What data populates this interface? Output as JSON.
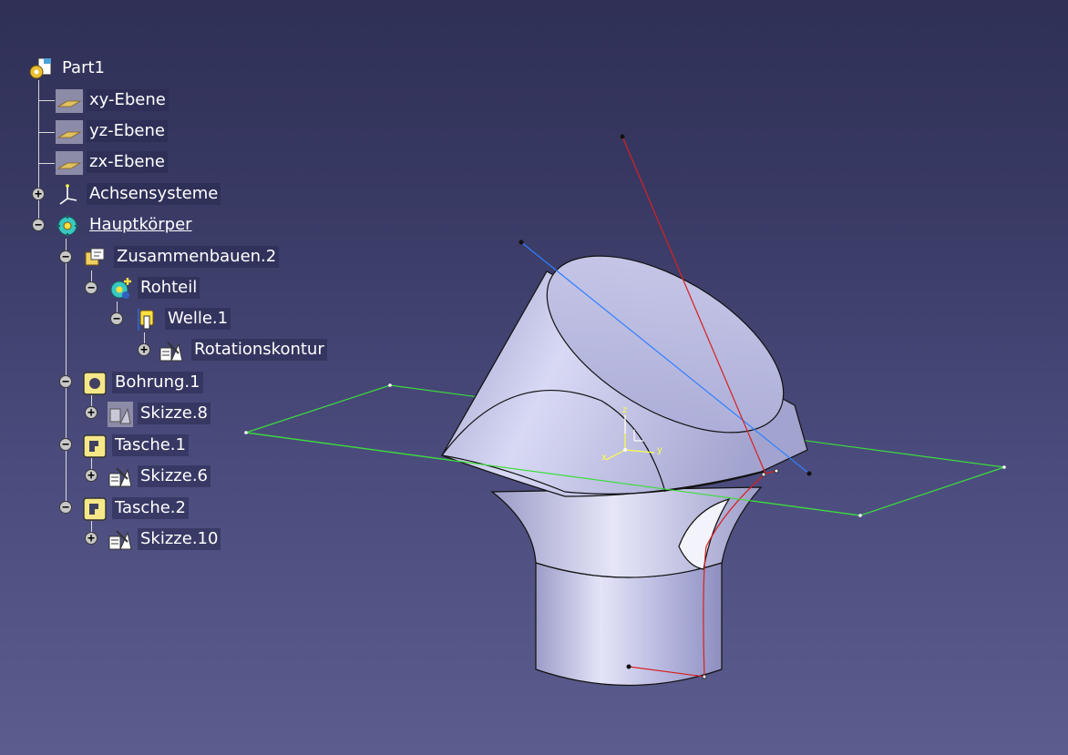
{
  "tree": {
    "root": {
      "label": "Part1",
      "icon": "part-icon"
    },
    "items": [
      {
        "id": "xy",
        "label": "xy-Ebene",
        "icon": "plane-icon"
      },
      {
        "id": "yz",
        "label": "yz-Ebene",
        "icon": "plane-icon"
      },
      {
        "id": "zx",
        "label": "zx-Ebene",
        "icon": "plane-icon"
      },
      {
        "id": "axes",
        "label": "Achsensysteme",
        "icon": "axis-system-icon",
        "toggle": "+"
      },
      {
        "id": "body",
        "label": "Hauptkörper",
        "icon": "body-icon",
        "toggle": "−"
      },
      {
        "id": "assemble",
        "label": "Zusammenbauen.2",
        "icon": "assemble-icon",
        "toggle": "−"
      },
      {
        "id": "rohteil",
        "label": "Rohteil",
        "icon": "body-icon",
        "toggle": "−"
      },
      {
        "id": "welle",
        "label": "Welle.1",
        "icon": "shaft-icon",
        "toggle": "−"
      },
      {
        "id": "rotkontur",
        "label": "Rotationskontur",
        "icon": "sketch-icon",
        "toggle": "+"
      },
      {
        "id": "bohrung",
        "label": "Bohrung.1",
        "icon": "hole-icon",
        "toggle": "−"
      },
      {
        "id": "skizze8",
        "label": "Skizze.8",
        "icon": "sketch-icon",
        "toggle": "+"
      },
      {
        "id": "tasche1",
        "label": "Tasche.1",
        "icon": "pocket-icon",
        "toggle": "−"
      },
      {
        "id": "skizze6",
        "label": "Skizze.6",
        "icon": "sketch-icon",
        "toggle": "+"
      },
      {
        "id": "tasche2",
        "label": "Tasche.2",
        "icon": "pocket-icon",
        "toggle": "−"
      },
      {
        "id": "skizze10",
        "label": "Skizze.10",
        "icon": "sketch-icon",
        "toggle": "+"
      }
    ]
  },
  "compass_labels": {
    "x": "x",
    "y": "y",
    "z": "z"
  },
  "colors": {
    "background_top": "#2f3056",
    "background_bottom": "#5c5d8f",
    "part_surface": "#b4b5dc",
    "plane_outline": "#3ddc3d",
    "axis_line": "#2f7fff",
    "sketch_line": "#d82020",
    "axis_marker": "#ffff44"
  }
}
